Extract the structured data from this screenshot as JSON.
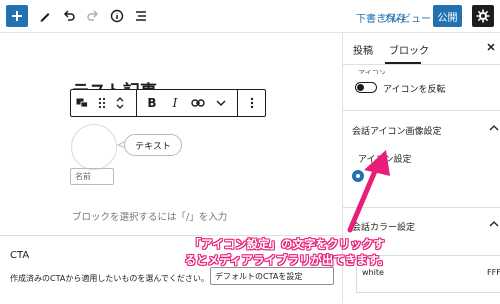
{
  "toolbar": {
    "save_draft": "下書き保存",
    "preview": "プレビュー",
    "publish": "公開",
    "icons": [
      "plus-icon",
      "pencil-icon",
      "undo-icon",
      "redo-icon",
      "info-icon",
      "list-view-icon",
      "gear-icon"
    ]
  },
  "editor": {
    "title": "テスト記事",
    "bubble_text": "テキスト",
    "name_placeholder": "名前",
    "block_placeholder": "ブロックを選択するには「/」を入力",
    "block_toolbar_icons": [
      "speech-bubble-block-icon",
      "drag-handle-icon",
      "move-up-down-icon",
      "bold-icon",
      "italic-icon",
      "link-icon",
      "more-rich-text-icon",
      "options-icon"
    ],
    "bold": "B",
    "italic": "I"
  },
  "cta": {
    "title": "CTA",
    "description": "作成済みのCTAから適用したいものを選んでください。",
    "select_value": "デフォルトのCTAを設定"
  },
  "sidebar": {
    "tab_post": "投稿",
    "tab_block": "ブロック",
    "clipped_text": "アイコン",
    "reverse_label": "アイコンを反転",
    "section_icon_image": "会話アイコン画像設定",
    "icon_setting": "アイコン設定",
    "section_color": "会話カラー設定",
    "color_name": "white",
    "color_hex": "FFF"
  },
  "annotation": {
    "line1": "「アイコン設定」の文字をクリックす",
    "line2": "るとメディアライブラリが出てきます。",
    "color": "#e91e7a"
  }
}
